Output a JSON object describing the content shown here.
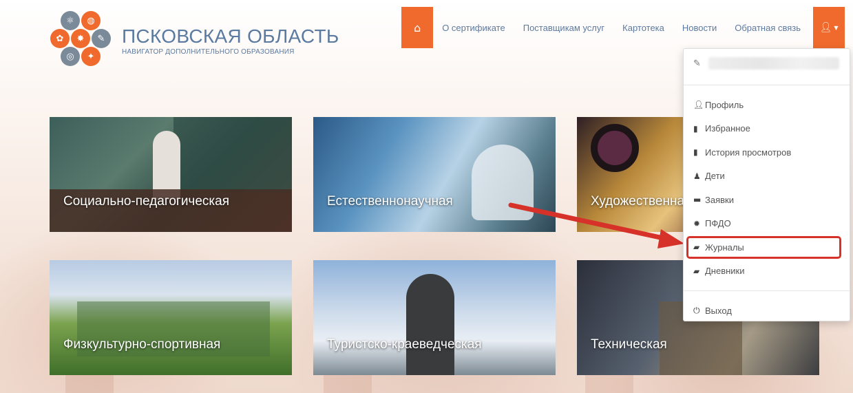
{
  "header": {
    "logo_title": "ПСКОВСКАЯ ОБЛАСТЬ",
    "logo_subtitle": "НАВИГАТОР ДОПОЛНИТЕЛЬНОГО ОБРАЗОВАНИЯ",
    "home_icon": "home-icon",
    "user_icon": "user-icon",
    "nav": [
      {
        "label": "О сертификате"
      },
      {
        "label": "Поставщикам услуг"
      },
      {
        "label": "Картотека"
      },
      {
        "label": "Новости"
      },
      {
        "label": "Обратная связь"
      }
    ]
  },
  "user_menu": {
    "edit_icon": "edit-icon",
    "items": [
      {
        "label": "Профиль",
        "icon": "user-icon"
      },
      {
        "label": "Избранное",
        "icon": "bookmark-icon"
      },
      {
        "label": "История просмотров",
        "icon": "bookmark-icon"
      },
      {
        "label": "Дети",
        "icon": "child-icon"
      },
      {
        "label": "Заявки",
        "icon": "folder-icon"
      },
      {
        "label": "ПФДО",
        "icon": "certificate-icon"
      },
      {
        "label": "Журналы",
        "icon": "book-icon",
        "highlighted": true
      },
      {
        "label": "Дневники",
        "icon": "book-icon"
      }
    ],
    "logout": {
      "label": "Выход",
      "icon": "power-icon"
    }
  },
  "categories": [
    {
      "label": "Социально-педагогическая"
    },
    {
      "label": "Естественнонаучная"
    },
    {
      "label": "Художественная"
    },
    {
      "label": "Физкультурно-спортивная"
    },
    {
      "label": "Туристско-краеведческая"
    },
    {
      "label": "Техническая"
    }
  ],
  "colors": {
    "accent": "#ef6a2c",
    "nav_text": "#5b7aa0",
    "highlight": "#d6322a"
  }
}
